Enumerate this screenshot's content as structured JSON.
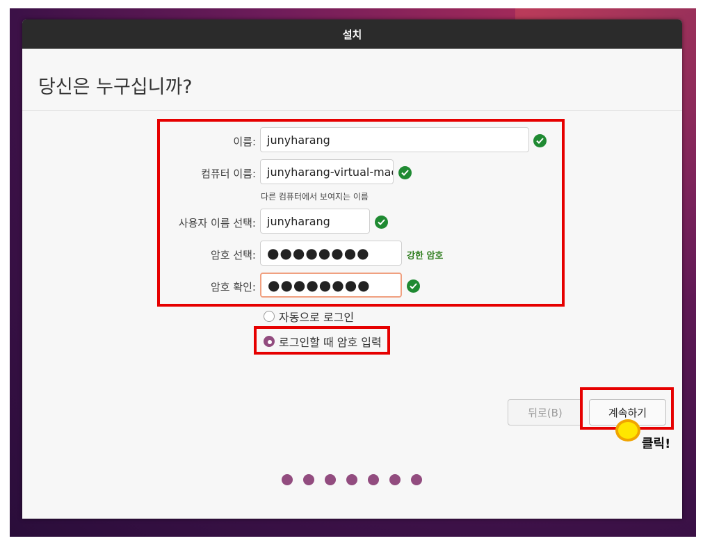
{
  "window": {
    "title": "설치"
  },
  "heading": "당신은 누구십니까?",
  "form": {
    "name": {
      "label": "이름:",
      "value": "junyharang"
    },
    "computer_name": {
      "label": "컴퓨터 이름:",
      "value": "junyharang-virtual-mac",
      "hint": "다른 컴퓨터에서 보여지는 이름"
    },
    "username": {
      "label": "사용자 이름 선택:",
      "value": "junyharang"
    },
    "password": {
      "label": "암호 선택:",
      "value": "●●●●●●●●",
      "strength": "강한 암호"
    },
    "confirm": {
      "label": "암호 확인:",
      "value": "●●●●●●●●"
    }
  },
  "login_options": {
    "auto_login": {
      "label": "자동으로 로그인",
      "selected": false
    },
    "require_password": {
      "label": "로그인할 때 암호 입력",
      "selected": true
    }
  },
  "buttons": {
    "back": "뒤로(B)",
    "continue": "계속하기"
  },
  "annotation": {
    "click_label": "클릭!"
  },
  "progress": {
    "total": 7
  },
  "colors": {
    "accent": "#924c7f",
    "valid": "#1f8a32",
    "highlight": "#e60000",
    "strength": "#2e7d1e"
  }
}
